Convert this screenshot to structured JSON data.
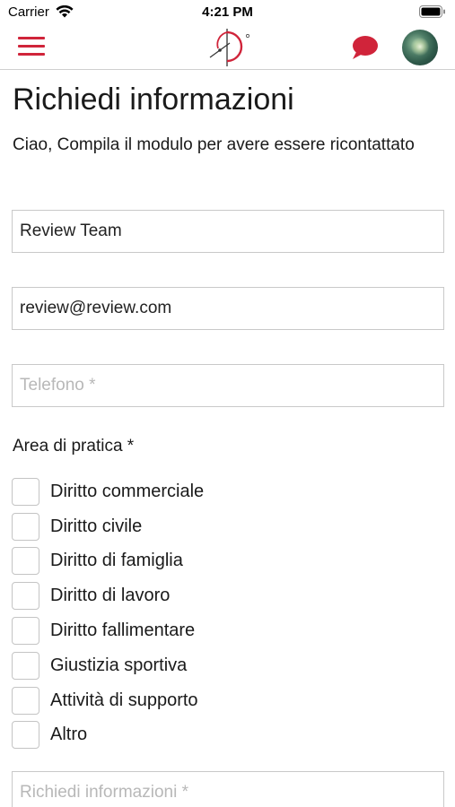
{
  "status_bar": {
    "carrier": "Carrier",
    "time": "4:21 PM"
  },
  "nav": {
    "menu_icon": "hamburger-menu-icon",
    "logo_icon": "brand-logo-icon",
    "chat_icon": "chat-bubble-icon",
    "accent_color": "#d0243a"
  },
  "page": {
    "title": "Richiedi informazioni",
    "subtitle": "Ciao, Compila il modulo per avere essere ricontattato"
  },
  "form": {
    "name": {
      "value": "Review Team",
      "placeholder": ""
    },
    "email": {
      "value": "review@review.com",
      "placeholder": ""
    },
    "phone": {
      "value": "",
      "placeholder": "Telefono *"
    },
    "area_label": "Area di pratica *",
    "areas": [
      {
        "label": "Diritto commerciale",
        "checked": false
      },
      {
        "label": "Diritto civile",
        "checked": false
      },
      {
        "label": "Diritto di famiglia",
        "checked": false
      },
      {
        "label": "Diritto di lavoro",
        "checked": false
      },
      {
        "label": "Diritto fallimentare",
        "checked": false
      },
      {
        "label": "Giustizia sportiva",
        "checked": false
      },
      {
        "label": "Attività di supporto",
        "checked": false
      },
      {
        "label": "Altro",
        "checked": false
      }
    ],
    "info": {
      "value": "",
      "placeholder": "Richiedi informazioni *"
    }
  }
}
